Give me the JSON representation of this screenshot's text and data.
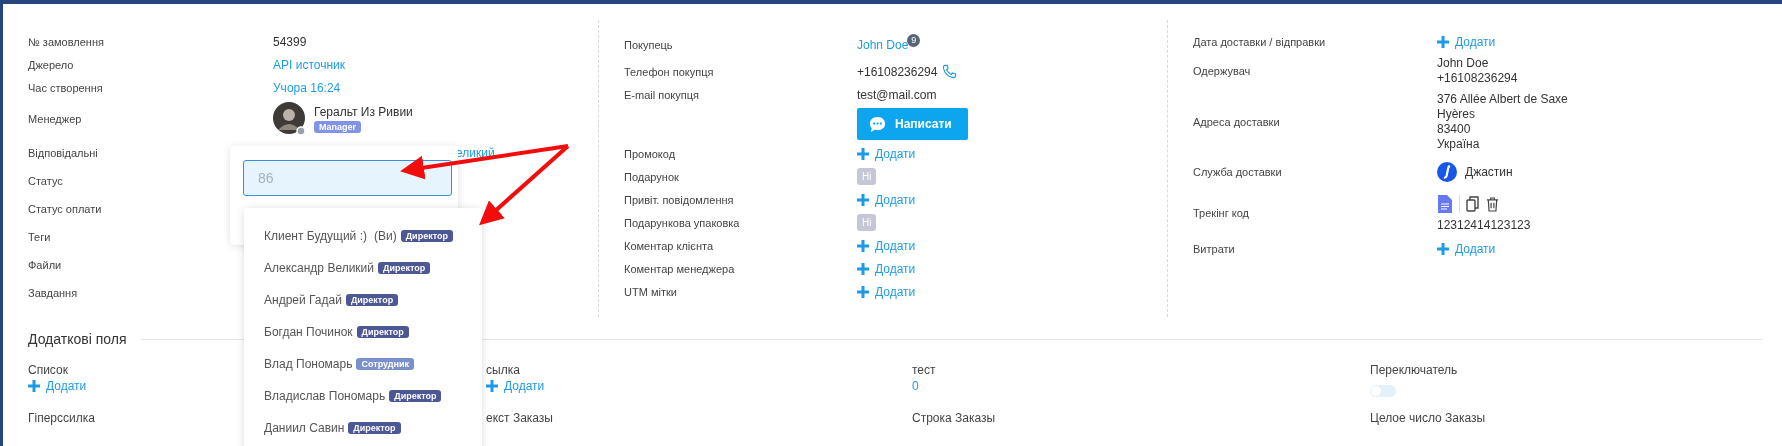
{
  "order_info": {
    "rows": [
      {
        "label": "№ замовлення",
        "kind": "text",
        "value": "54399"
      },
      {
        "label": "Джерело",
        "kind": "link",
        "value": "API источник"
      },
      {
        "label": "Час створення",
        "kind": "link",
        "value": "Учора 16:24"
      },
      {
        "label": "Менеджер",
        "kind": "manager",
        "value": "Геральт Из Ривии",
        "role": "Manager"
      },
      {
        "label": "Відповідальні",
        "kind": "covered-link",
        "value": "еликий"
      },
      {
        "label": "Статус",
        "kind": "empty"
      },
      {
        "label": "Статус оплати",
        "kind": "empty"
      },
      {
        "label": "Теги",
        "kind": "empty"
      },
      {
        "label": "Файли",
        "kind": "empty"
      },
      {
        "label": "Завдання",
        "kind": "empty"
      }
    ]
  },
  "customer": {
    "rows": [
      {
        "label": "Покупець",
        "kind": "customer",
        "value": "John Doe",
        "count": "9"
      },
      {
        "label": "Телефон покупця",
        "kind": "phone",
        "value": "+16108236294"
      },
      {
        "label": "E-mail покупця",
        "kind": "text",
        "value": "test@mail.com"
      },
      {
        "kind": "button",
        "value": "Написати"
      },
      {
        "label": "Промокод",
        "kind": "add",
        "value": "Додати"
      },
      {
        "label": "Подарунок",
        "kind": "badge",
        "value": "Ні"
      },
      {
        "label": "Привіт. повідомлення",
        "kind": "add",
        "value": "Додати"
      },
      {
        "label": "Подарункова упаковка",
        "kind": "badge",
        "value": "Ні"
      },
      {
        "label": "Коментар клієнта",
        "kind": "add",
        "value": "Додати"
      },
      {
        "label": "Коментар менеджера",
        "kind": "add",
        "value": "Додати"
      },
      {
        "label": "UTM мітки",
        "kind": "add",
        "value": "Додати"
      }
    ]
  },
  "delivery": {
    "rows": [
      {
        "label": "Дата доставки / відправки",
        "kind": "add",
        "value": "Додати"
      },
      {
        "label": "Одержувач",
        "kind": "lines",
        "lines": [
          "John Doe",
          "+16108236294"
        ]
      },
      {
        "label": "Адреса доставки",
        "kind": "lines",
        "lines": [
          "376 Allée Albert de Saxe",
          "Hyères",
          "83400",
          "Україна"
        ]
      },
      {
        "label": "Служба доставки",
        "kind": "service",
        "value": "Джастин"
      },
      {
        "label": "Трекінг код",
        "kind": "tracking",
        "value": "12312414123123"
      },
      {
        "label": "Витрати",
        "kind": "add",
        "value": "Додати"
      }
    ]
  },
  "extra_fields": {
    "title": "Додаткові поля",
    "fields": [
      {
        "label": "Список",
        "kind": "add",
        "value": "Додати"
      },
      {
        "label": "сылка",
        "kind": "add",
        "value": "Додати"
      },
      {
        "label": "тест",
        "kind": "link",
        "value": "0"
      },
      {
        "label": "Переключатель",
        "kind": "switch",
        "on": false
      },
      {
        "label": "Гіперссилка",
        "kind": "empty"
      },
      {
        "label": "екст Заказы",
        "kind": "empty"
      },
      {
        "label": "Строка Заказы",
        "kind": "empty"
      },
      {
        "label": "Целое число Заказы",
        "kind": "empty"
      }
    ]
  },
  "search_popover": {
    "placeholder": "86"
  },
  "user_dropdown": {
    "items": [
      {
        "name": "Клиент Будущий :)",
        "note": "(Ви)",
        "role": "Директор",
        "color": "#4d5796"
      },
      {
        "name": "Александр Великий",
        "role": "Директор",
        "color": "#4d5796"
      },
      {
        "name": "Андрей Гадай",
        "role": "Директор",
        "color": "#4d5796"
      },
      {
        "name": "Богдан Починок",
        "role": "Директор",
        "color": "#4d5796"
      },
      {
        "name": "Влад Пономарь",
        "role": "Сотрудник",
        "color": "#7a90cc"
      },
      {
        "name": "Владислав Пономарь",
        "role": "Директор",
        "color": "#4d5796"
      },
      {
        "name": "Даниил Савин",
        "role": "Директор",
        "color": "#4d5796"
      }
    ]
  }
}
